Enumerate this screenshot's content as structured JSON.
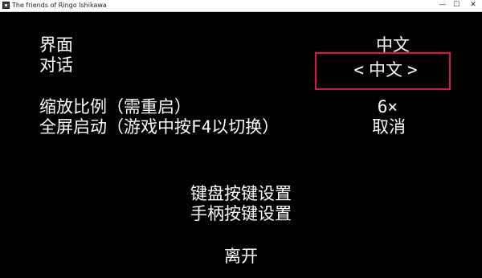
{
  "window": {
    "title": "The friends of Ringo Ishikawa",
    "minimize_glyph": "—",
    "maximize_glyph": "☐",
    "close_glyph": "✕"
  },
  "settings": {
    "interface": {
      "label": "界面",
      "value": "中文"
    },
    "dialogue": {
      "label": "对话",
      "value": "中文",
      "left_arrow": "<",
      "right_arrow": ">"
    },
    "scale": {
      "label": "缩放比例（需重启）",
      "value": "6×"
    },
    "fullscreen": {
      "label": "全屏启动（游戏中按F4以切换）",
      "value": "取消"
    }
  },
  "menu": {
    "keyboard_keys": "键盘按键设置",
    "gamepad_keys": "手柄按键设置",
    "exit": "离开"
  },
  "colors": {
    "highlight": "#e0134a",
    "background": "#000000",
    "text": "#ffffff"
  }
}
